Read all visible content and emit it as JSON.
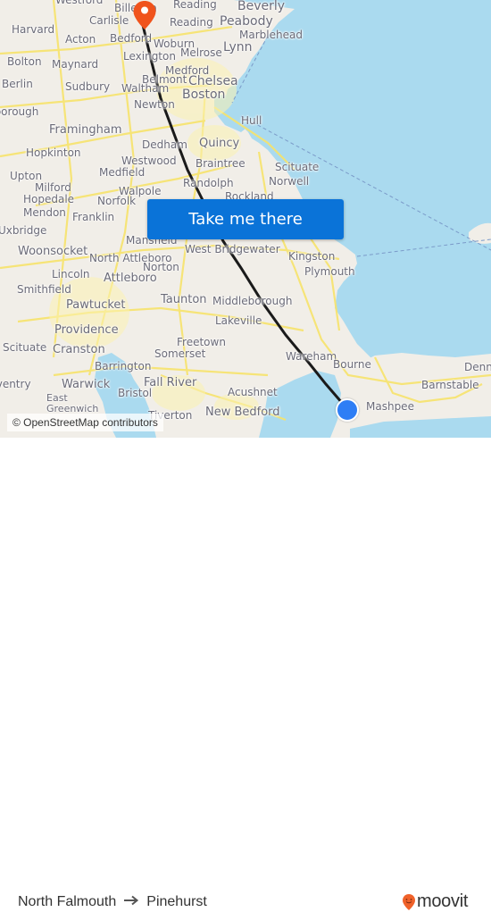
{
  "map": {
    "cta_label": "Take me there",
    "attribution": "© OpenStreetMap contributors",
    "colors": {
      "land": "#f1eee8",
      "water": "#aadaef",
      "roads": "#f7e36b",
      "route_line": "#1a1a1a",
      "destination_marker": "#f0531c",
      "origin_marker": "#2e7ef5",
      "cta_background": "#0a73d8"
    },
    "markers": {
      "destination": {
        "icon": "map-pin-icon",
        "place": "Pinehurst"
      },
      "origin": {
        "icon": "current-location-dot-icon",
        "place": "North Falmouth"
      }
    },
    "places": [
      {
        "name": "Westford"
      },
      {
        "name": "Billerica"
      },
      {
        "name": "Reading"
      },
      {
        "name": "Beverly"
      },
      {
        "name": "Carlisle"
      },
      {
        "name": "Reading"
      },
      {
        "name": "Peabody"
      },
      {
        "name": "Harvard"
      },
      {
        "name": "Marblehead"
      },
      {
        "name": "Acton"
      },
      {
        "name": "Bedford"
      },
      {
        "name": "Woburn"
      },
      {
        "name": "Lynn"
      },
      {
        "name": "Lexington"
      },
      {
        "name": "Melrose"
      },
      {
        "name": "Bolton"
      },
      {
        "name": "Maynard"
      },
      {
        "name": "Medford"
      },
      {
        "name": "Berlin"
      },
      {
        "name": "Belmont"
      },
      {
        "name": "Chelsea"
      },
      {
        "name": "Sudbury"
      },
      {
        "name": "Waltham"
      },
      {
        "name": "Boston"
      },
      {
        "name": "Newton"
      },
      {
        "name": "Hull"
      },
      {
        "name": "Northborough"
      },
      {
        "name": "Framingham"
      },
      {
        "name": "Dedham"
      },
      {
        "name": "Quincy"
      },
      {
        "name": "Hopkinton"
      },
      {
        "name": "Westwood"
      },
      {
        "name": "Braintree"
      },
      {
        "name": "Upton"
      },
      {
        "name": "Medfield"
      },
      {
        "name": "Scituate"
      },
      {
        "name": "Milford"
      },
      {
        "name": "Randolph"
      },
      {
        "name": "Norwell"
      },
      {
        "name": "Hopedale"
      },
      {
        "name": "Walpole"
      },
      {
        "name": "Norfolk"
      },
      {
        "name": "Rockland"
      },
      {
        "name": "Mendon"
      },
      {
        "name": "Franklin"
      },
      {
        "name": "Uxbridge"
      },
      {
        "name": "Mansfield"
      },
      {
        "name": "West Bridgewater"
      },
      {
        "name": "Woonsocket"
      },
      {
        "name": "North Attleboro"
      },
      {
        "name": "Kingston"
      },
      {
        "name": "Norton"
      },
      {
        "name": "Lincoln"
      },
      {
        "name": "Plymouth"
      },
      {
        "name": "Attleboro"
      },
      {
        "name": "Smithfield"
      },
      {
        "name": "Taunton"
      },
      {
        "name": "Middleborough"
      },
      {
        "name": "Pawtucket"
      },
      {
        "name": "Lakeville"
      },
      {
        "name": "Providence"
      },
      {
        "name": "Freetown"
      },
      {
        "name": "Scituate"
      },
      {
        "name": "Cranston"
      },
      {
        "name": "Somerset"
      },
      {
        "name": "Wareham"
      },
      {
        "name": "Barrington"
      },
      {
        "name": "Bourne"
      },
      {
        "name": "Warwick"
      },
      {
        "name": "Fall River"
      },
      {
        "name": "Acushnet"
      },
      {
        "name": "Barnstable"
      },
      {
        "name": "Dennis"
      },
      {
        "name": "East Greenwich"
      },
      {
        "name": "Bristol"
      },
      {
        "name": "Mashpee"
      },
      {
        "name": "New Bedford"
      },
      {
        "name": "Tiverton"
      },
      {
        "name": "Coventry"
      }
    ]
  },
  "footer": {
    "origin": "North Falmouth",
    "arrow_icon": "arrow-right-icon",
    "destination": "Pinehurst",
    "brand": "moovit"
  }
}
